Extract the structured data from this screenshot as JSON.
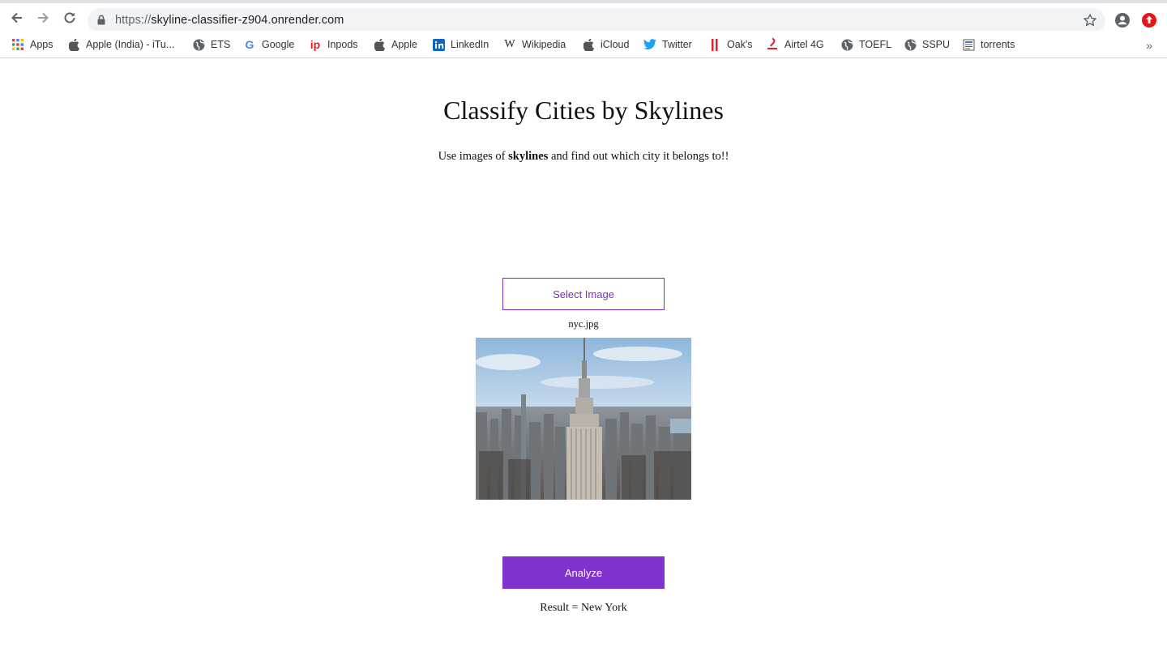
{
  "browser": {
    "url_protocol": "https://",
    "url_host": "skyline-classifier-z904.onrender.com",
    "bookmarks": [
      {
        "label": "Apps",
        "icon": "apps-grid-icon"
      },
      {
        "label": "Apple (India) - iTu...",
        "icon": "apple-icon"
      },
      {
        "label": "ETS",
        "icon": "globe-icon"
      },
      {
        "label": "Google",
        "icon": "google-icon"
      },
      {
        "label": "Inpods",
        "icon": "inpods-icon"
      },
      {
        "label": "Apple",
        "icon": "apple-icon"
      },
      {
        "label": "LinkedIn",
        "icon": "linkedin-icon"
      },
      {
        "label": "Wikipedia",
        "icon": "wikipedia-icon"
      },
      {
        "label": "iCloud",
        "icon": "apple-icon"
      },
      {
        "label": "Twitter",
        "icon": "twitter-icon"
      },
      {
        "label": "Oak's",
        "icon": "oaks-icon"
      },
      {
        "label": "Airtel 4G",
        "icon": "airtel-icon"
      },
      {
        "label": "TOEFL",
        "icon": "globe-icon"
      },
      {
        "label": "SSPU",
        "icon": "globe-icon"
      },
      {
        "label": "torrents",
        "icon": "document-icon"
      }
    ],
    "more_bookmarks": "»"
  },
  "page": {
    "title": "Classify Cities by Skylines",
    "subtitle_pre": "Use images of ",
    "subtitle_bold": "skylines",
    "subtitle_post": " and find out which city it belongs to!!",
    "select_button": "Select Image",
    "filename": "nyc.jpg",
    "analyze_button": "Analyze",
    "result": "Result = New York"
  },
  "colors": {
    "accent": "#8033cc",
    "outline": "#7b2fbe"
  }
}
